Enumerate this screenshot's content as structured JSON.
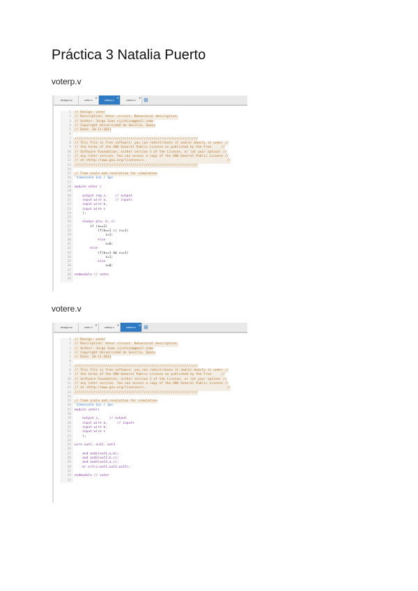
{
  "title": "Práctica 3 Natalia Puerto",
  "sections": [
    {
      "filename": "voterp.v",
      "tabs": [
        "design.sv",
        "voter.v",
        "voterp.v",
        "votere.v"
      ],
      "active_tab": 2,
      "lines": [
        {
          "k": "c",
          "t": "// Design: voter"
        },
        {
          "k": "c",
          "t": "// Description: Voter circuit. Behavioral description."
        },
        {
          "k": "c",
          "t": "// Author: Jorge Juan <jjchico@gmail.com>"
        },
        {
          "k": "c",
          "t": "// Copyright Universidad de Sevilla, Spain"
        },
        {
          "k": "c",
          "t": "// Date: 10-11-2011"
        },
        {
          "k": "p",
          "t": ""
        },
        {
          "k": "c",
          "t": "////////////////////////////////////////////////////////////////"
        },
        {
          "k": "c",
          "t": "// This file is free software: you can redistribute it and/or modify it under //"
        },
        {
          "k": "c",
          "t": "// the terms of the GNU General Public License as published by the Free     //"
        },
        {
          "k": "c",
          "t": "// Software Foundation, either version 3 of the License, or (at your option) //"
        },
        {
          "k": "c",
          "t": "// any later version. You can access a copy of the GNU General Public License //"
        },
        {
          "k": "c",
          "t": "// at <http://www.gnu.org/licenses/>.                                          //"
        },
        {
          "k": "c",
          "t": "////////////////////////////////////////////////////////////////"
        },
        {
          "k": "p",
          "t": ""
        },
        {
          "k": "c",
          "t": "// Time scale and resolution for simulation"
        },
        {
          "k": "d",
          "t": "`timescale 1ns / 1ps"
        },
        {
          "k": "p",
          "t": ""
        },
        {
          "k": "k",
          "t": "module voter ("
        },
        {
          "k": "p",
          "t": ""
        },
        {
          "k": "k",
          "t": "    output reg z,    // output"
        },
        {
          "k": "k",
          "t": "    input wire a,    // inputs"
        },
        {
          "k": "k",
          "t": "    input wire b,"
        },
        {
          "k": "k",
          "t": "    input wire c"
        },
        {
          "k": "p",
          "t": "    );"
        },
        {
          "k": "p",
          "t": ""
        },
        {
          "k": "k",
          "t": "    always @(a, b, c)"
        },
        {
          "k": "p",
          "t": "        if (a==1)"
        },
        {
          "k": "p",
          "t": "            if(b==1 || c==1)"
        },
        {
          "k": "p",
          "t": "                z=1;"
        },
        {
          "k": "k",
          "t": "            else"
        },
        {
          "k": "p",
          "t": "                z=0;"
        },
        {
          "k": "k",
          "t": "        else"
        },
        {
          "k": "p",
          "t": "            if(b==1 && c==1)"
        },
        {
          "k": "p",
          "t": "                z=1;"
        },
        {
          "k": "k",
          "t": "            else"
        },
        {
          "k": "p",
          "t": "                z=0;"
        },
        {
          "k": "p",
          "t": ""
        },
        {
          "k": "k",
          "t": "endmodule // voter"
        },
        {
          "k": "p",
          "t": ""
        }
      ]
    },
    {
      "filename": "votere.v",
      "tabs": [
        "design.sv",
        "voter.v",
        "voterp.v",
        "votere.v"
      ],
      "active_tab": 3,
      "lines": [
        {
          "k": "c",
          "t": "// Design: voter"
        },
        {
          "k": "c",
          "t": "// Description: Voter circuit. Behavioral description."
        },
        {
          "k": "c",
          "t": "// Author: Jorge Juan <jjchico@gmail.com>"
        },
        {
          "k": "c",
          "t": "// Copyright Universidad de Sevilla, Spain"
        },
        {
          "k": "c",
          "t": "// Date: 10-11-2011"
        },
        {
          "k": "p",
          "t": ""
        },
        {
          "k": "c",
          "t": "////////////////////////////////////////////////////////////////"
        },
        {
          "k": "c",
          "t": "// This file is free software: you can redistribute it and/or modify it under //"
        },
        {
          "k": "c",
          "t": "// the terms of the GNU General Public License as published by the Free     //"
        },
        {
          "k": "c",
          "t": "// Software Foundation, either version 3 of the License, or (at your option) //"
        },
        {
          "k": "c",
          "t": "// any later version. You can access a copy of the GNU General Public License //"
        },
        {
          "k": "c",
          "t": "// at <http://www.gnu.org/licenses/>.                                          //"
        },
        {
          "k": "c",
          "t": "////////////////////////////////////////////////////////////////"
        },
        {
          "k": "p",
          "t": ""
        },
        {
          "k": "c",
          "t": "// Time scale and resolution for simulation"
        },
        {
          "k": "d",
          "t": "`timescale 1ns / 1ps"
        },
        {
          "k": "k",
          "t": "module voter("
        },
        {
          "k": "p",
          "t": ""
        },
        {
          "k": "k",
          "t": "    output z,     // output"
        },
        {
          "k": "k",
          "t": "    input wire a,     // inputs"
        },
        {
          "k": "k",
          "t": "    input wire b,"
        },
        {
          "k": "k",
          "t": "    input wire c"
        },
        {
          "k": "p",
          "t": "    );"
        },
        {
          "k": "p",
          "t": ""
        },
        {
          "k": "k",
          "t": "wire out1, out2, out3"
        },
        {
          "k": "p",
          "t": ""
        },
        {
          "k": "k",
          "t": "    and and1(out1,a,b);"
        },
        {
          "k": "k",
          "t": "    and and2(out2,b,c);"
        },
        {
          "k": "k",
          "t": "    and and3(out3,a,c);"
        },
        {
          "k": "k",
          "t": "    or or1(z,out1,out2,out3);"
        },
        {
          "k": "p",
          "t": ""
        },
        {
          "k": "k",
          "t": "endmodule // voter"
        },
        {
          "k": "p",
          "t": ""
        }
      ]
    }
  ]
}
